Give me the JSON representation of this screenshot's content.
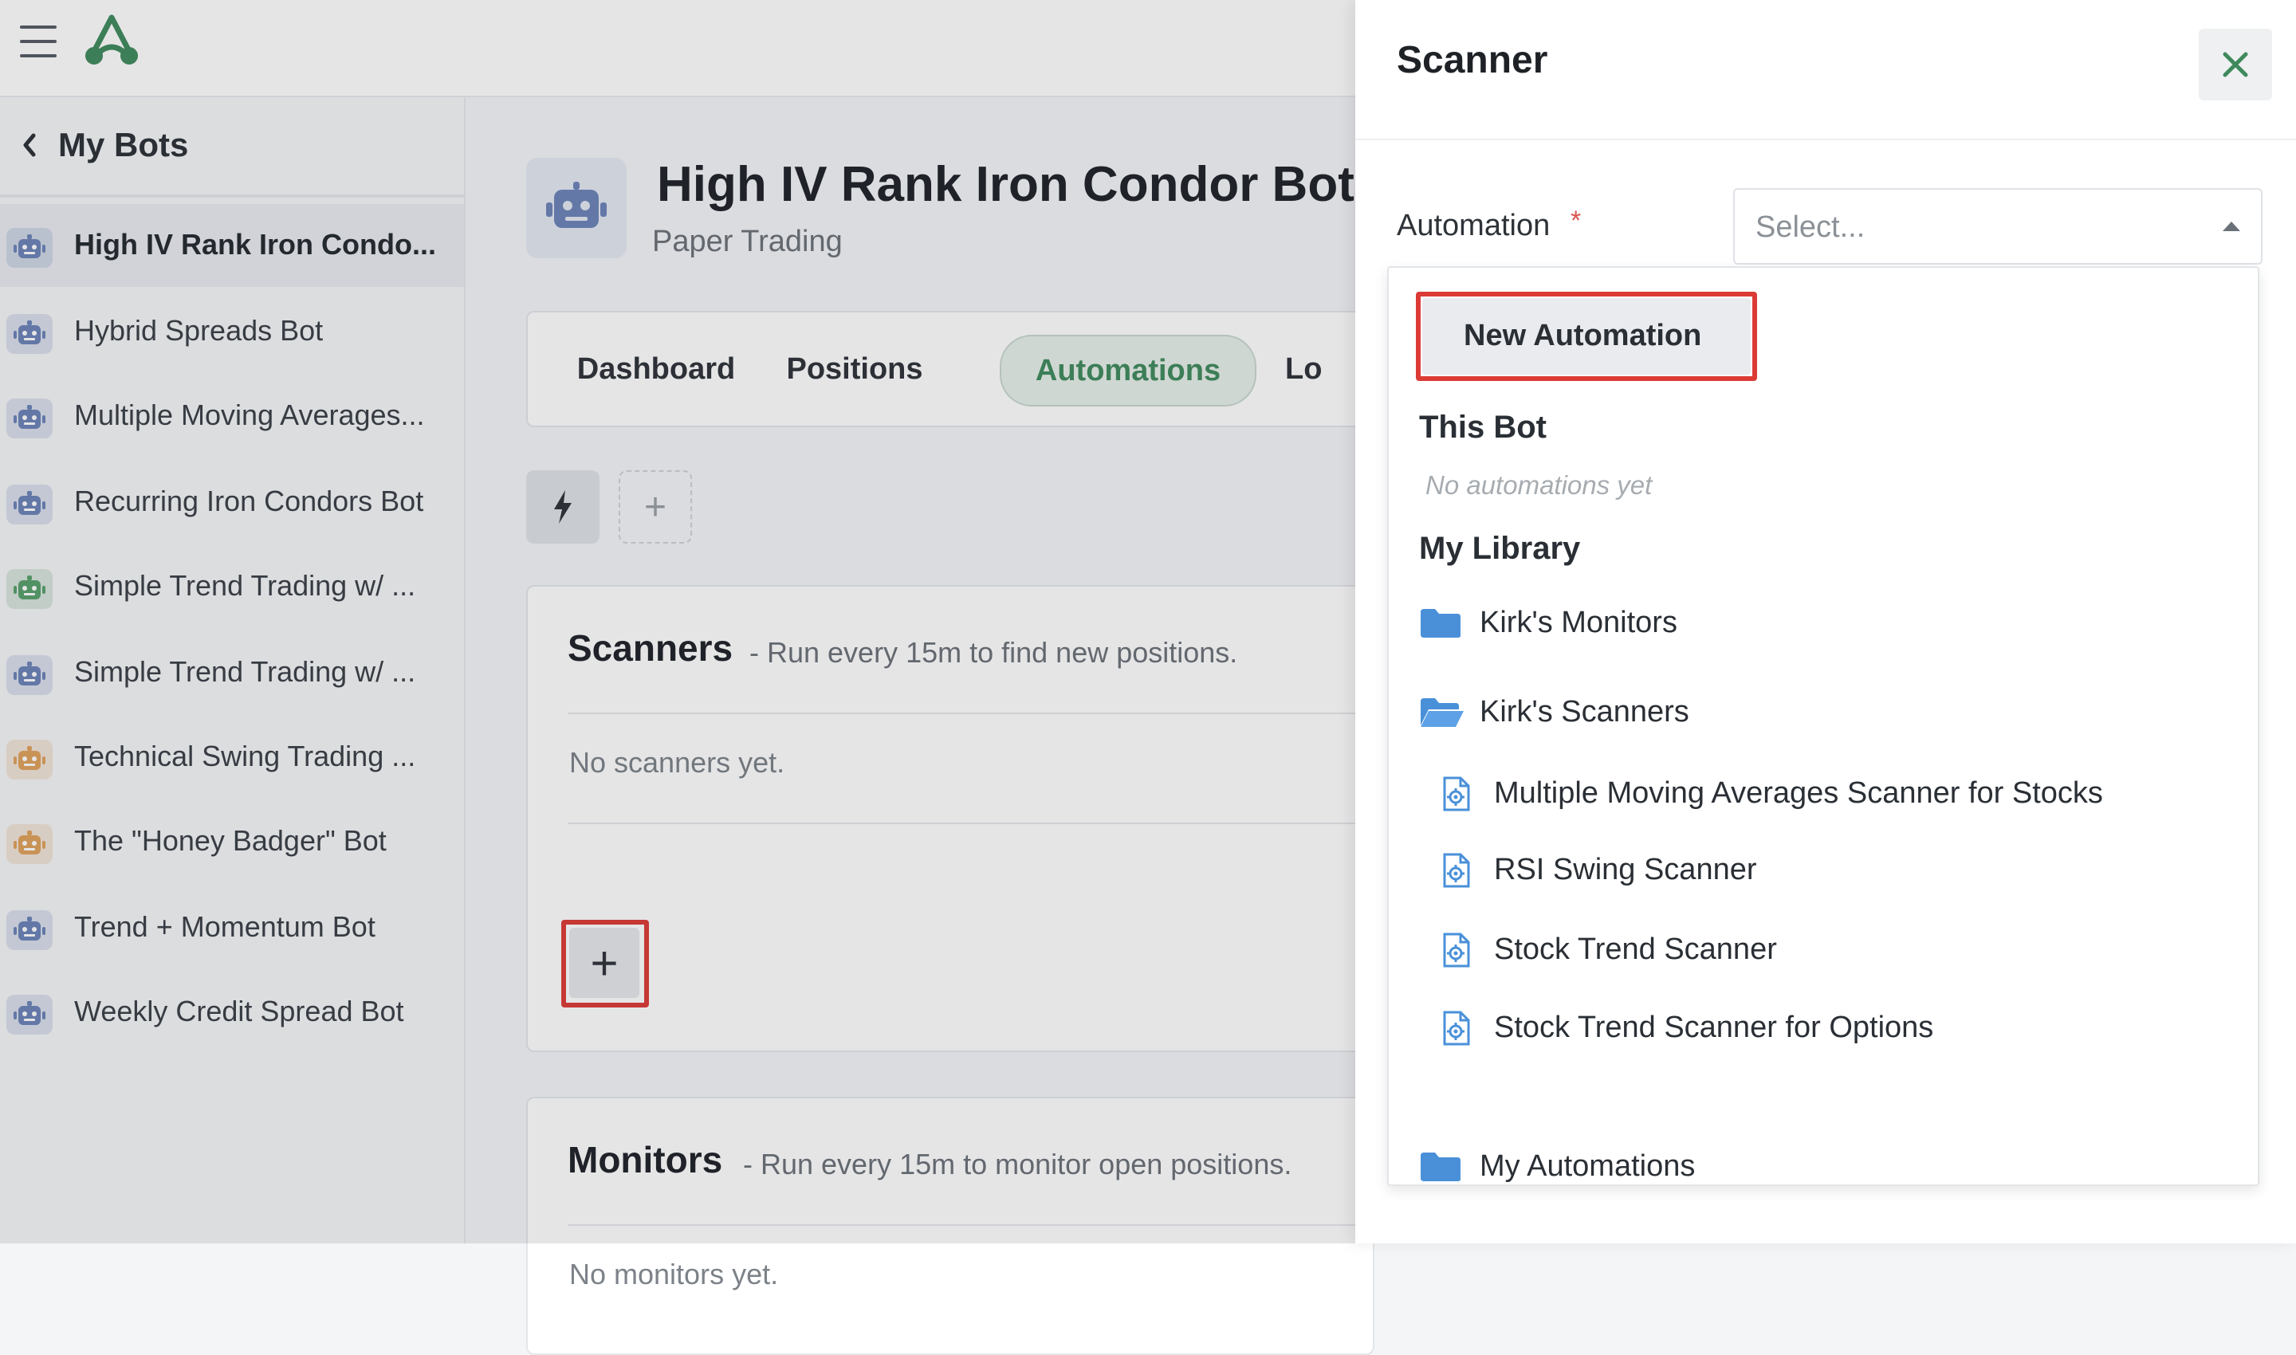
{
  "topbar": {
    "menu_icon": "hamburger-icon",
    "logo_icon": "app-logo-icon"
  },
  "sidebar": {
    "back_label": "My Bots",
    "bots": [
      {
        "name": "High IV Rank Iron Condo...",
        "icon_color": "#6b83b8",
        "active": true
      },
      {
        "name": "Hybrid Spreads Bot",
        "icon_color": "#6b83b8"
      },
      {
        "name": "Multiple Moving Averages...",
        "icon_color": "#6b83b8"
      },
      {
        "name": "Recurring Iron Condors Bot",
        "icon_color": "#6b83b8"
      },
      {
        "name": "Simple Trend Trading w/ ...",
        "icon_color": "#58a06b"
      },
      {
        "name": "Simple Trend Trading w/ ...",
        "icon_color": "#6b83b8"
      },
      {
        "name": "Technical Swing Trading ...",
        "icon_color": "#e0a25c"
      },
      {
        "name": "The \"Honey Badger\" Bot",
        "icon_color": "#e0a25c"
      },
      {
        "name": "Trend + Momentum Bot",
        "icon_color": "#6b83b8"
      },
      {
        "name": "Weekly Credit Spread Bot",
        "icon_color": "#6b83b8"
      }
    ]
  },
  "main": {
    "bot_title": "High IV Rank Iron Condor Bot",
    "bot_subtitle": "Paper Trading",
    "tabs": [
      {
        "label": "Dashboard"
      },
      {
        "label": "Positions"
      },
      {
        "label": "Automations",
        "active": true
      },
      {
        "label": "Lo"
      }
    ],
    "scanners": {
      "title": "Scanners",
      "desc": "- Run every 15m to find new positions.",
      "empty": "No scanners yet.",
      "add_label": "+"
    },
    "monitors": {
      "title": "Monitors",
      "desc": "- Run every 15m to monitor open positions.",
      "empty": "No monitors yet."
    },
    "toolbar_add": "+"
  },
  "drawer": {
    "title": "Scanner",
    "close_label": "✕",
    "field_label": "Automation",
    "required_mark": "*",
    "placeholder": "Select...",
    "dropdown": {
      "new_automation": "New Automation",
      "this_bot_header": "This Bot",
      "this_bot_empty": "No automations yet",
      "library_header": "My Library",
      "folders": [
        {
          "name": "Kirk's Monitors",
          "icon": "folder-icon"
        },
        {
          "name": "Kirk's Scanners",
          "icon": "folder-open-icon"
        }
      ],
      "scanners": [
        "Multiple Moving Averages Scanner for Stocks",
        "RSI Swing Scanner",
        "Stock Trend Scanner",
        "Stock Trend Scanner for Options"
      ],
      "my_automations": "My Automations"
    }
  },
  "colors": {
    "accent": "#3f8a5d",
    "highlight": "#dc3b35",
    "folder": "#4a90d9"
  }
}
